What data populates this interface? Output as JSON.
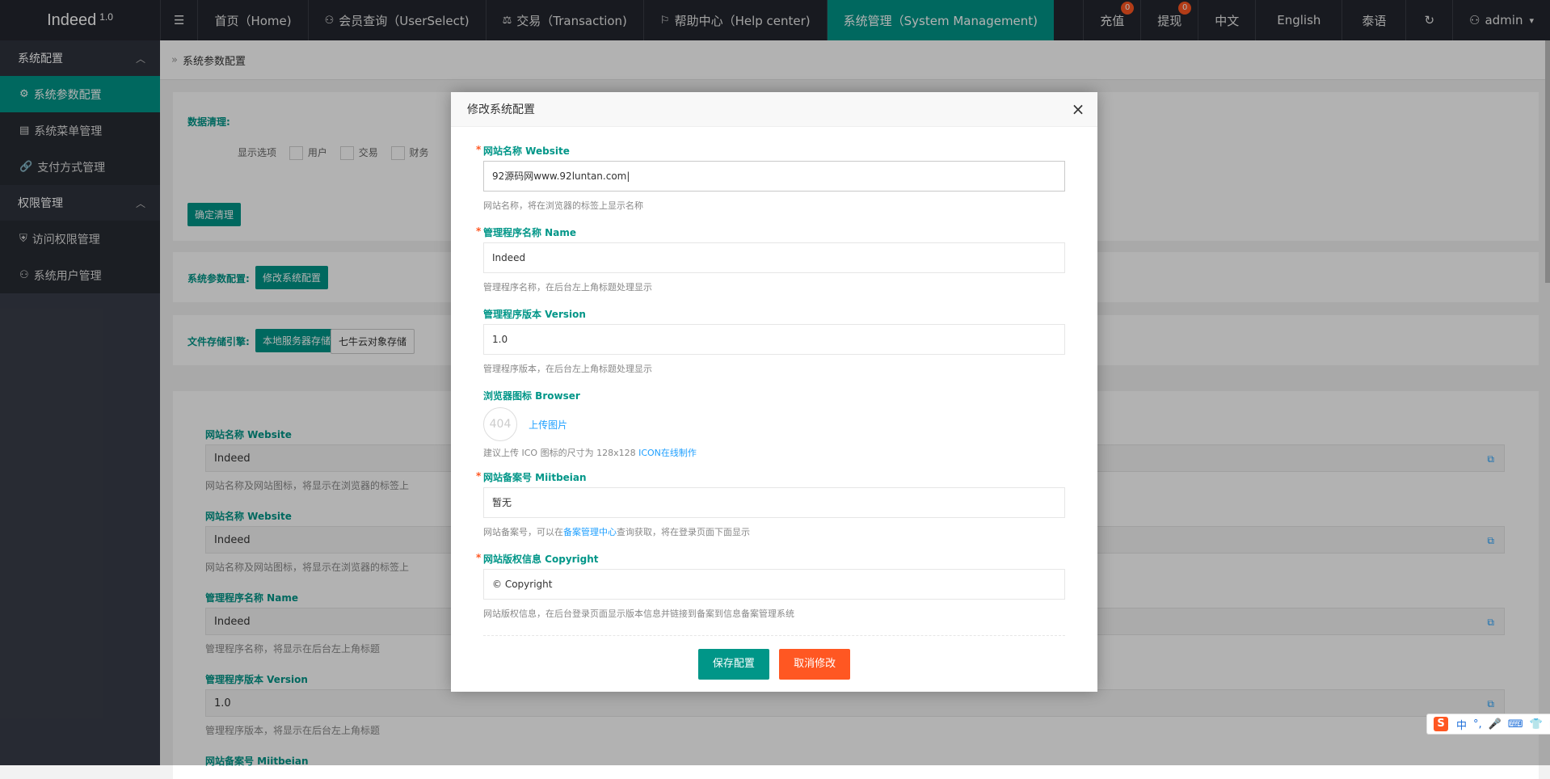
{
  "header": {
    "logo": "Indeed",
    "version": "1.0",
    "menu_icon": "☰",
    "nav": [
      {
        "label": "首页（Home)",
        "icon": ""
      },
      {
        "label": "会员查询（UserSelect)",
        "icon": "user-icon"
      },
      {
        "label": "交易（Transaction)",
        "icon": "scale-icon"
      },
      {
        "label": "帮助中心（Help center)",
        "icon": "flag-icon"
      },
      {
        "label": "系统管理（System Management)",
        "icon": "",
        "active": true
      }
    ],
    "right": {
      "recharge": "充值",
      "recharge_badge": "0",
      "withdraw": "提现",
      "withdraw_badge": "0",
      "lang_zh": "中文",
      "lang_en": "English",
      "lang_th": "泰语",
      "user": "admin"
    }
  },
  "sidebar": {
    "group1": "系统配置",
    "items1": [
      "系统参数配置",
      "系统菜单管理",
      "支付方式管理"
    ],
    "group2": "权限管理",
    "items2": [
      "访问权限管理",
      "系统用户管理"
    ]
  },
  "main": {
    "breadcrumb": "系统参数配置",
    "data_clean": {
      "label": "数据清理:",
      "options_label": "显示选项",
      "options": [
        "用户",
        "交易",
        "财务"
      ],
      "button": "确定清理"
    },
    "sys_param": {
      "label": "系统参数配置:",
      "button": "修改系统配置"
    },
    "storage": {
      "label": "文件存储引擎:",
      "local": "本地服务器存储",
      "qiniu": "七牛云对象存储"
    },
    "fields": [
      {
        "label": "网站名称 Website",
        "value": "Indeed",
        "tip": "网站名称及网站图标，将显示在浏览器的标签上"
      },
      {
        "label": "网站名称 Website",
        "value": "Indeed",
        "tip": "网站名称及网站图标，将显示在浏览器的标签上"
      },
      {
        "label": "管理程序名称 Name",
        "value": "Indeed",
        "tip": "管理程序名称，将显示在后台左上角标题"
      },
      {
        "label": "管理程序版本 Version",
        "value": "1.0",
        "tip": "管理程序版本，将显示在后台左上角标题"
      },
      {
        "label": "网站备案号 Miitbeian",
        "value": "",
        "tip": ""
      }
    ]
  },
  "modal": {
    "title": "修改系统配置",
    "close": "×",
    "website_label": "网站名称 Website",
    "website_value": "92源码网www.92luntan.com",
    "website_tip": "网站名称，将在浏览器的标签上显示名称",
    "name_label": "管理程序名称 Name",
    "name_value": "Indeed",
    "name_tip": "管理程序名称，在后台左上角标题处理显示",
    "version_label": "管理程序版本 Version",
    "version_value": "1.0",
    "version_tip": "管理程序版本，在后台左上角标题处理显示",
    "browser_label": "浏览器图标 Browser",
    "browser_placeholder": "404",
    "upload": "上传图片",
    "browser_tip": "建议上传 ICO 图标的尺寸为 128x128 ",
    "browser_tip_link": "ICON在线制作",
    "miit_label": "网站备案号 Miitbeian",
    "miit_value": "暂无",
    "miit_tip_a": "网站备案号，可以在",
    "miit_tip_link": "备案管理中心",
    "miit_tip_b": "查询获取，将在登录页面下面显示",
    "copyright_label": "网站版权信息 Copyright",
    "copyright_value": "© Copyright",
    "copyright_tip": "网站版权信息，在后台登录页面显示版本信息并链接到备案到信息备案管理系统",
    "save": "保存配置",
    "cancel": "取消修改"
  },
  "ime": {
    "logo": "S",
    "items": [
      "中",
      "°,",
      "🎤",
      "⌨",
      "👕",
      "▦"
    ]
  }
}
